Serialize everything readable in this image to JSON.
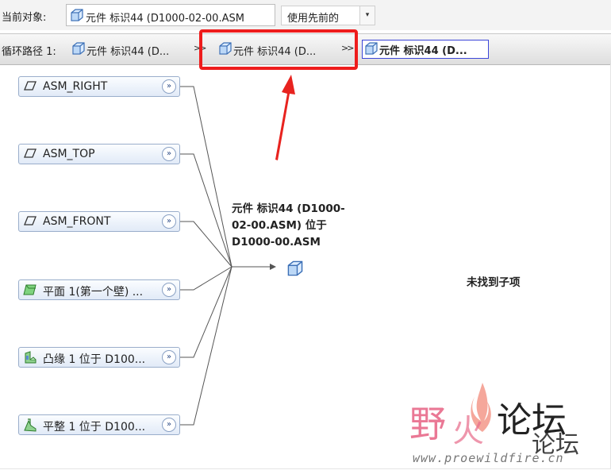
{
  "toolbar": {
    "current_label": "当前对象:",
    "current_value": "元件 标识44 (D1000-02-00.ASM",
    "mode_value": "使用先前的",
    "dropdown_arrow": "▾"
  },
  "path": {
    "label": "循环路径 1:",
    "separator": ">>",
    "crumbs": [
      "元件 标识44 (D...",
      "元件 标识44 (D...",
      "元件 标识44 (D..."
    ]
  },
  "nodes": [
    {
      "label": "ASM_RIGHT",
      "icon": "datum-plane-icon"
    },
    {
      "label": "ASM_TOP",
      "icon": "datum-plane-icon"
    },
    {
      "label": "ASM_FRONT",
      "icon": "datum-plane-icon"
    },
    {
      "label": "平面 1(第一个壁) ...",
      "icon": "sheetmetal-wall-icon"
    },
    {
      "label": "凸缘 1 位于 D100...",
      "icon": "flange-feature-icon"
    },
    {
      "label": "平整 1 位于 D100...",
      "icon": "flatten-feature-icon"
    }
  ],
  "expand_glyph": "»",
  "target": {
    "line1": "元件 标识44 (D1000-",
    "line2": "02-00.ASM) 位于",
    "line3": "D1000-00.ASM"
  },
  "no_children": "未找到子项",
  "watermark": {
    "brand": "野火论坛",
    "url": "www.proewildfire.cn"
  },
  "colors": {
    "accent_red": "#ee1c1c",
    "node_border": "#9aaecb",
    "current_crumb_border": "#3c46d9"
  }
}
